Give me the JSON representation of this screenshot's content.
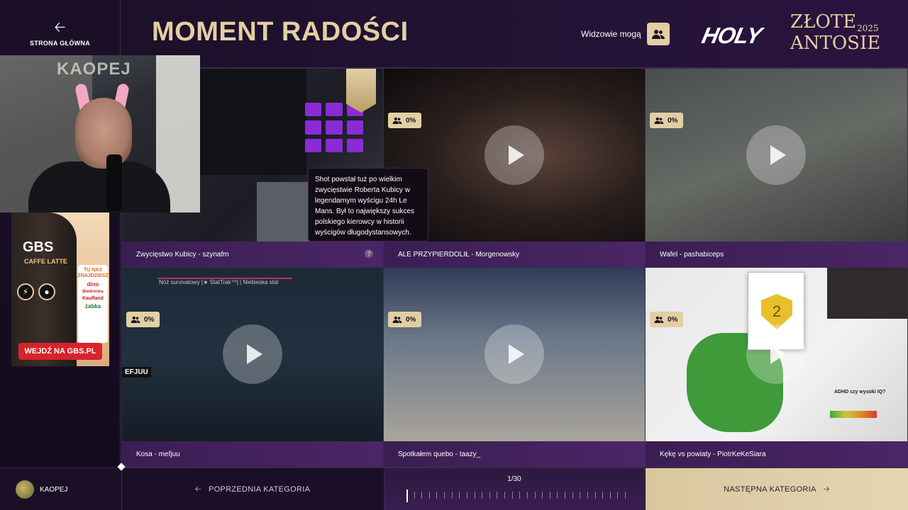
{
  "header": {
    "home_label": "STRONA GŁÓWNA",
    "title": "MOMENT RADOŚCI",
    "viewers_label": "Widzowie mogą",
    "logo": {
      "brand": "HOLY",
      "line1": "ZŁOTE",
      "line2": "ANTOSIE",
      "year": "2025"
    }
  },
  "webcam": {
    "sign_text": "KAOPEJ"
  },
  "ad": {
    "brand": "GBS",
    "flavor": "CAFFE LATTE",
    "stores_heading": "TU NAS ZNAJDZIESZ",
    "stores": [
      "dino",
      "Biedronka",
      "Kaufland",
      "żabka"
    ],
    "cta": "WEJDŹ NA GBS.PL"
  },
  "tiles": [
    {
      "caption": "Zwycięstwo Kubicy - szynafm"
    },
    {
      "caption": "ALE PRZYPIERDOLIŁ - Morgenowsky",
      "percent": "0%"
    },
    {
      "caption": "Wafel - pashabiceps",
      "percent": "0%"
    },
    {
      "caption": "Kosa - mefjuu",
      "percent": "0%",
      "overlay_title": "Nóż survivalowy [★ StatTrak™] | Niebieska stal",
      "overlay_tag": "EFJUU"
    },
    {
      "caption": "Spotkałem quebo - taazy_",
      "percent": "0%"
    },
    {
      "caption": "Kękę vs powiaty - PiotrKeKeSiara",
      "percent": "0%",
      "dialog_number": "2",
      "iq_label": "ADHD czy wysoki IQ?"
    }
  ],
  "tooltip": {
    "text": "Shot powstał tuż po wielkim zwycięstwie Roberta Kubicy w legendarnym wyścigu 24h Le Mans. Był to największy sukces polskiego kierowcy w historii wyścigów długodystansowych.",
    "trigger": "?"
  },
  "footer": {
    "username": "KAOPEJ",
    "prev_label": "POPRZEDNIA KATEGORIA",
    "page_indicator": "1/30",
    "current_index": 1,
    "total": 30,
    "next_label": "NASTĘPNA KATEGORIA"
  },
  "colors": {
    "gold": "#e2cfa3",
    "bg": "#160d22",
    "caption_purple": "#4b2666"
  }
}
